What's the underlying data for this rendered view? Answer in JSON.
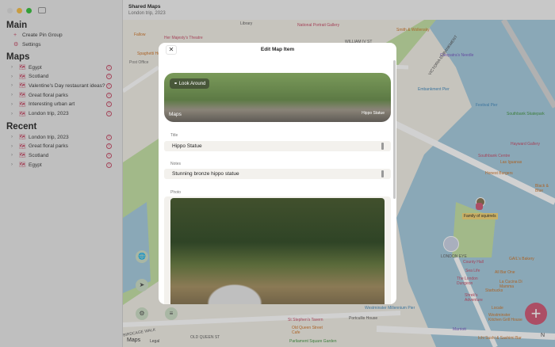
{
  "window": {
    "title": "Shared Maps",
    "subtitle": "London trip, 2023"
  },
  "sidebar": {
    "main_heading": "Main",
    "main_items": [
      {
        "label": "Create Pin Group",
        "icon": "plus-icon"
      },
      {
        "label": "Settings",
        "icon": "gear-icon"
      }
    ],
    "maps_heading": "Maps",
    "maps": [
      {
        "label": "Egypt"
      },
      {
        "label": "Scotland"
      },
      {
        "label": "Valentine's Day restaurant ideas?"
      },
      {
        "label": "Great floral parks"
      },
      {
        "label": "Interesting urban art"
      },
      {
        "label": "London trip, 2023"
      }
    ],
    "recent_heading": "Recent",
    "recent": [
      {
        "label": "London trip, 2023"
      },
      {
        "label": "Great floral parks"
      },
      {
        "label": "Scotland"
      },
      {
        "label": "Egypt"
      }
    ]
  },
  "modal": {
    "title": "Edit Map Item",
    "close_icon": "close-icon",
    "look_around": "Look Around",
    "maps_brand": "Maps",
    "look_caption": "Hippo Statue",
    "title_label": "Title",
    "title_value": "Hippo Statue",
    "notes_label": "Notes",
    "notes_value": "Stunning bronze hippo statue",
    "photo_label": "Photo"
  },
  "map": {
    "labels": [
      "Library",
      "National Portrait Gallery",
      "WILLIAM IV ST",
      "Smith & Wollensky",
      "Fallow",
      "Her Majesty's Theatre",
      "Spaghetti House",
      "Post Office",
      "VICTORIA EMBANKMENT",
      "Cleopatra's Needle",
      "Embankment Pier",
      "Festival Pier",
      "Southbank Skatepark",
      "Hayward Gallery",
      "Southbank Centre",
      "Las Iguanas",
      "Honest Burgers",
      "Black & Blue",
      "Family of squirrels",
      "LONDON EYE",
      "County Hall",
      "Sea Life",
      "The London Dungeon",
      "Shrek's Adventure",
      "GAIL's Bakery",
      "All Bar One",
      "La Cucina Di Mamma",
      "Starbucks",
      "Locale",
      "Westminster Kitchen Grill House",
      "Marriott",
      "Ichi Sushi & Sashimi Bar",
      "St Stephen's Tavern",
      "Portcullis House",
      "Old Queen Street Cafe",
      "OLD QUEEN ST",
      "BIRDCAGE WALK",
      "Parliament Square Garden",
      "Westminster Millennium Pier"
    ],
    "brand": "Maps",
    "legal": "Legal",
    "compass": "N"
  },
  "colors": {
    "accent": "#d2607c",
    "water": "#a9cde0",
    "park": "#c6e2a8"
  }
}
